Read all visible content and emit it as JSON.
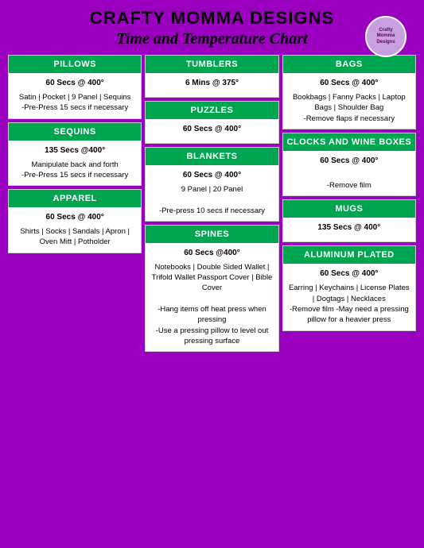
{
  "header": {
    "title": "CRAFTY MOMMA DESIGNS",
    "subtitle": "Time and Temperature Chart",
    "logo_text": "Crafty Momma Designs"
  },
  "columns": [
    {
      "sections": [
        {
          "name": "pillows",
          "header": "PILLOWS",
          "time": "60 Secs @ 400°",
          "details": "Satin | Pocket | 9 Panel | Sequins\n-Pre-Press 15 secs if necessary"
        },
        {
          "name": "sequins",
          "header": "SEQUINS",
          "time": "135 Secs @400°",
          "details": "Manipulate back and forth\n-Pre-Press 15 secs if necessary"
        },
        {
          "name": "apparel",
          "header": "APPAREL",
          "time": "60 Secs @ 400°",
          "details": "Shirts | Socks | Sandals | Apron | Oven Mitt | Potholder"
        }
      ]
    },
    {
      "sections": [
        {
          "name": "tumblers",
          "header": "TUMBLERS",
          "time": "6 Mins @ 375°",
          "details": ""
        },
        {
          "name": "puzzles",
          "header": "PUZZLES",
          "time": "60 Secs @ 400°",
          "details": ""
        },
        {
          "name": "blankets",
          "header": "BLANKETS",
          "time": "60 Secs @ 400°",
          "details": "9 Panel | 20 Panel\n\n-Pre-press 10 secs if necessary"
        },
        {
          "name": "spines",
          "header": "SPINES",
          "time": "60 Secs @400°",
          "details": "Notebooks | Double Sided Wallet | Trifold Wallet Passport Cover | Bible Cover\n\n-Hang items off heat press when pressing\n-Use a pressing pillow to level out pressing surface"
        }
      ]
    },
    {
      "sections": [
        {
          "name": "bags",
          "header": "BAGS",
          "time": "60 Secs @ 400°",
          "details": "Bookbags | Fanny Packs | Laptop Bags | Shoulder Bag\n-Remove flaps if necessary"
        },
        {
          "name": "clocks-wine-boxes",
          "header": "CLOCKS AND WINE BOXES",
          "time": "60 Secs @ 400°",
          "details": "\n-Remove film"
        },
        {
          "name": "mugs",
          "header": "MUGS",
          "time": "135 Secs @  400°",
          "details": ""
        },
        {
          "name": "aluminum-plated",
          "header": "ALUMINUM PLATED",
          "time": "60 Secs @ 400°",
          "details": "Earring | Keychains | License Plates | Dogtags | Necklaces\n-Remove film -May need a pressing pillow for a heavier press"
        }
      ]
    }
  ]
}
